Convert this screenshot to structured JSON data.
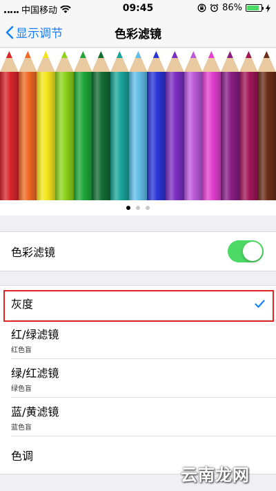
{
  "status_bar": {
    "carrier": "中国移动",
    "time": "09:45",
    "battery_percent": "86%",
    "battery_level": 0.86,
    "icons": [
      "signal-icon",
      "wifi-icon",
      "rotation-lock-icon",
      "alarm-icon",
      "charging-icon",
      "battery-icon"
    ]
  },
  "nav": {
    "back_label": "显示调节",
    "title": "色彩滤镜"
  },
  "preview": {
    "pencil_colors": [
      "#d9262c",
      "#f06a25",
      "#f5e61c",
      "#8cd31b",
      "#1ea83a",
      "#136d33",
      "#1aa59c",
      "#62bde9",
      "#2a35d6",
      "#7a2ec2",
      "#bb59db",
      "#e43fd0",
      "#8a1d84",
      "#a01659",
      "#6a2d17"
    ],
    "page_indicator": {
      "count": 3,
      "active": 0
    }
  },
  "filter_toggle": {
    "label": "色彩滤镜",
    "on": true
  },
  "options": [
    {
      "title": "灰度",
      "subtitle": "",
      "selected": true
    },
    {
      "title": "红/绿滤镜",
      "subtitle": "红色盲",
      "selected": false
    },
    {
      "title": "绿/红滤镜",
      "subtitle": "绿色盲",
      "selected": false
    },
    {
      "title": "蓝/黄滤镜",
      "subtitle": "蓝色盲",
      "selected": false
    },
    {
      "title": "色调",
      "subtitle": "",
      "selected": false
    }
  ],
  "watermark": "云南龙网",
  "colors": {
    "accent": "#157efb",
    "toggle_on": "#4cd964",
    "highlight": "#e02424"
  }
}
